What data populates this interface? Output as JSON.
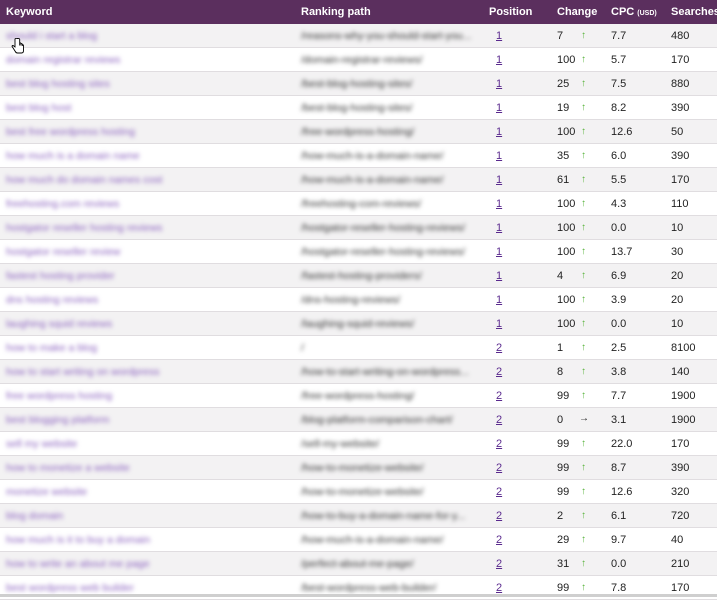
{
  "header": {
    "keyword": "Keyword",
    "ranking_path": "Ranking path",
    "position": "Position",
    "change": "Change",
    "cpc": "CPC",
    "cpc_unit": "(USD)",
    "searches": "Searches"
  },
  "colors": {
    "header_bg": "#5b2f5e",
    "up_arrow": "#57b33a",
    "link": "#5a2a8e"
  },
  "rows": [
    {
      "keyword": "should i start a blog",
      "path": "/reasons-why-you-should-start-you...",
      "position": "1",
      "change": "7",
      "trend": "up",
      "cpc": "7.7",
      "searches": "480"
    },
    {
      "keyword": "domain registrar reviews",
      "path": "/domain-registrar-reviews/",
      "position": "1",
      "change": "100",
      "trend": "up",
      "cpc": "5.7",
      "searches": "170"
    },
    {
      "keyword": "best blog hosting sites",
      "path": "/best-blog-hosting-sites/",
      "position": "1",
      "change": "25",
      "trend": "up",
      "cpc": "7.5",
      "searches": "880"
    },
    {
      "keyword": "best blog host",
      "path": "/best-blog-hosting-sites/",
      "position": "1",
      "change": "19",
      "trend": "up",
      "cpc": "8.2",
      "searches": "390"
    },
    {
      "keyword": "best free wordpress hosting",
      "path": "/free-wordpress-hosting/",
      "position": "1",
      "change": "100",
      "trend": "up",
      "cpc": "12.6",
      "searches": "50"
    },
    {
      "keyword": "how much is a domain name",
      "path": "/how-much-is-a-domain-name/",
      "position": "1",
      "change": "35",
      "trend": "up",
      "cpc": "6.0",
      "searches": "390"
    },
    {
      "keyword": "how much do domain names cost",
      "path": "/how-much-is-a-domain-name/",
      "position": "1",
      "change": "61",
      "trend": "up",
      "cpc": "5.5",
      "searches": "170"
    },
    {
      "keyword": "freehosting.com reviews",
      "path": "/freehosting-com-reviews/",
      "position": "1",
      "change": "100",
      "trend": "up",
      "cpc": "4.3",
      "searches": "110"
    },
    {
      "keyword": "hostgator reseller hosting reviews",
      "path": "/hostgator-reseller-hosting-reviews/",
      "position": "1",
      "change": "100",
      "trend": "up",
      "cpc": "0.0",
      "searches": "10"
    },
    {
      "keyword": "hostgator reseller review",
      "path": "/hostgator-reseller-hosting-reviews/",
      "position": "1",
      "change": "100",
      "trend": "up",
      "cpc": "13.7",
      "searches": "30"
    },
    {
      "keyword": "fastest hosting provider",
      "path": "/fastest-hosting-providers/",
      "position": "1",
      "change": "4",
      "trend": "up",
      "cpc": "6.9",
      "searches": "20"
    },
    {
      "keyword": "dns hosting reviews",
      "path": "/dns-hosting-reviews/",
      "position": "1",
      "change": "100",
      "trend": "up",
      "cpc": "3.9",
      "searches": "20"
    },
    {
      "keyword": "laughing squid reviews",
      "path": "/laughing-squid-reviews/",
      "position": "1",
      "change": "100",
      "trend": "up",
      "cpc": "0.0",
      "searches": "10"
    },
    {
      "keyword": "how to make a blog",
      "path": "/",
      "position": "2",
      "change": "1",
      "trend": "up",
      "cpc": "2.5",
      "searches": "8100"
    },
    {
      "keyword": "how to start writing on wordpress",
      "path": "/how-to-start-writing-on-wordpress...",
      "position": "2",
      "change": "8",
      "trend": "up",
      "cpc": "3.8",
      "searches": "140"
    },
    {
      "keyword": "free wordpress hosting",
      "path": "/free-wordpress-hosting/",
      "position": "2",
      "change": "99",
      "trend": "up",
      "cpc": "7.7",
      "searches": "1900"
    },
    {
      "keyword": "best blogging platform",
      "path": "/blog-platform-comparison-chart/",
      "position": "2",
      "change": "0",
      "trend": "flat",
      "cpc": "3.1",
      "searches": "1900"
    },
    {
      "keyword": "sell my website",
      "path": "/sell-my-website/",
      "position": "2",
      "change": "99",
      "trend": "up",
      "cpc": "22.0",
      "searches": "170"
    },
    {
      "keyword": "how to monetize a website",
      "path": "/how-to-monetize-website/",
      "position": "2",
      "change": "99",
      "trend": "up",
      "cpc": "8.7",
      "searches": "390"
    },
    {
      "keyword": "monetize website",
      "path": "/how-to-monetize-website/",
      "position": "2",
      "change": "99",
      "trend": "up",
      "cpc": "12.6",
      "searches": "320"
    },
    {
      "keyword": "blog domain",
      "path": "/how-to-buy-a-domain-name-for-y...",
      "position": "2",
      "change": "2",
      "trend": "up",
      "cpc": "6.1",
      "searches": "720"
    },
    {
      "keyword": "how much is it to buy a domain",
      "path": "/how-much-is-a-domain-name/",
      "position": "2",
      "change": "29",
      "trend": "up",
      "cpc": "9.7",
      "searches": "40"
    },
    {
      "keyword": "how to write an about me page",
      "path": "/perfect-about-me-page/",
      "position": "2",
      "change": "31",
      "trend": "up",
      "cpc": "0.0",
      "searches": "210"
    },
    {
      "keyword": "best wordpress web builder",
      "path": "/best-wordpress-web-builder/",
      "position": "2",
      "change": "99",
      "trend": "up",
      "cpc": "7.8",
      "searches": "170"
    }
  ]
}
